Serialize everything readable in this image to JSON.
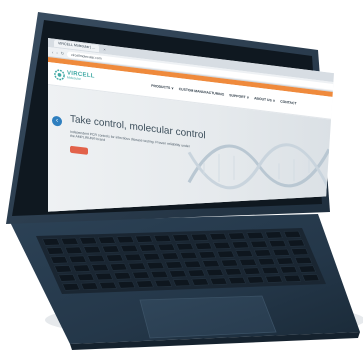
{
  "browser": {
    "tab_title": "VIRCELL Molecular | ...",
    "tab_close": "×",
    "url": "vircellmolecular.com",
    "nav_back": "‹",
    "nav_forward": "›",
    "nav_reload": "↻"
  },
  "promo_bar": {
    "text": ""
  },
  "site": {
    "logo_name": "VIRCELL",
    "logo_sub": "Molecular",
    "menu": [
      {
        "label": "PRODUCTS ∨"
      },
      {
        "label": "CUSTOM MANUFACTURING"
      },
      {
        "label": "SUPPORT ∨"
      },
      {
        "label": "ABOUT US ∨"
      },
      {
        "label": "CONTACT"
      }
    ]
  },
  "hero": {
    "title": "Take control, molecular control",
    "subtitle": "Independent PCR controls for infectious disease testing. Proven reliability under the AMPLIRUN® brand",
    "button_label": "",
    "prev_arrow": "‹",
    "next_arrow": "›"
  },
  "colors": {
    "brand_teal": "#3fa9a4",
    "accent_blue": "#2f7fbf",
    "promo_orange": "#ef8a3c",
    "cta_red": "#e2624a",
    "device_body": "#26384a"
  },
  "icons": {
    "logo": "vircell-logo-icon",
    "cart": "cart-icon",
    "dna": "dna-helix-image",
    "prev": "chevron-left-icon",
    "next": "chevron-right-icon"
  }
}
